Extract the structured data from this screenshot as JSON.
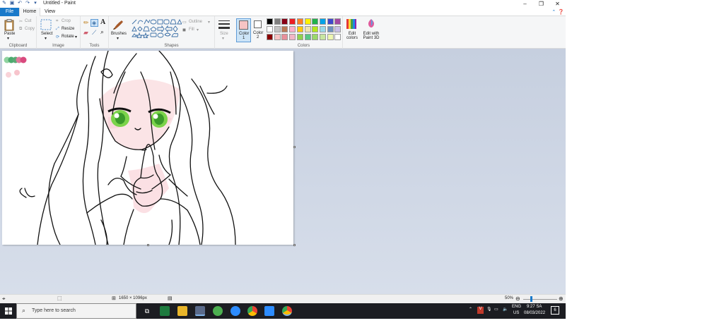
{
  "window": {
    "title": "Untitled - Paint",
    "controls": [
      "minimize-icon",
      "maximize-icon",
      "close-icon"
    ]
  },
  "tabs": [
    {
      "label": "File"
    },
    {
      "label": "Home"
    },
    {
      "label": "View"
    }
  ],
  "ribbon": {
    "clipboard": {
      "group_label": "Clipboard",
      "paste": "Paste",
      "cut": "Cut",
      "copy": "Copy"
    },
    "image": {
      "group_label": "Image",
      "select": "Select",
      "crop": "Crop",
      "resize": "Resize",
      "rotate": "Rotate"
    },
    "tools": {
      "group_label": "Tools"
    },
    "brushes": {
      "label": "Brushes"
    },
    "shapes": {
      "group_label": "Shapes",
      "outline": "Outline",
      "fill": "Fill"
    },
    "size": {
      "label": "Size"
    },
    "color1": {
      "label": "Color",
      "num": "1",
      "value": "#f7c4c4"
    },
    "color2": {
      "label": "Color",
      "num": "2",
      "value": "#ffffff"
    },
    "colors": {
      "group_label": "Colors",
      "palette_row1": [
        "#000000",
        "#7f7f7f",
        "#880015",
        "#ed1c24",
        "#ff7f27",
        "#fff200",
        "#22b14c",
        "#00a2e8",
        "#3f48cc",
        "#a349a4"
      ],
      "palette_row2": [
        "#ffffff",
        "#c3c3c3",
        "#b97a57",
        "#ffaec9",
        "#ffc90e",
        "#efe4b0",
        "#b5e61d",
        "#99d9ea",
        "#7092be",
        "#c8bfe7"
      ],
      "palette_row3": [
        "#8b0000",
        "#f7c4c4",
        "#e8909a",
        "#f2b6c6",
        "#8fd14f",
        "#57c785",
        "#9ad86a",
        "#c8e6a0",
        "#eef7b0",
        "#ffffff"
      ]
    },
    "edit_colors": "Edit colors",
    "edit_with_3d": "Edit with Paint 3D"
  },
  "canvas": {
    "swatch_colors": [
      "#8fd3a0",
      "#4bab6e",
      "#5aa875",
      "#e1799c",
      "#d94a7e",
      "#f9d3d8",
      "#f7c4cc"
    ]
  },
  "status": {
    "dimensions": "1650 × 1096px",
    "zoom": "50%"
  },
  "taskbar": {
    "search_placeholder": "Type here to search",
    "language": "ENG",
    "region": "US",
    "time": "9:27 SA",
    "date": "08/03/2022",
    "notifications": "6"
  }
}
